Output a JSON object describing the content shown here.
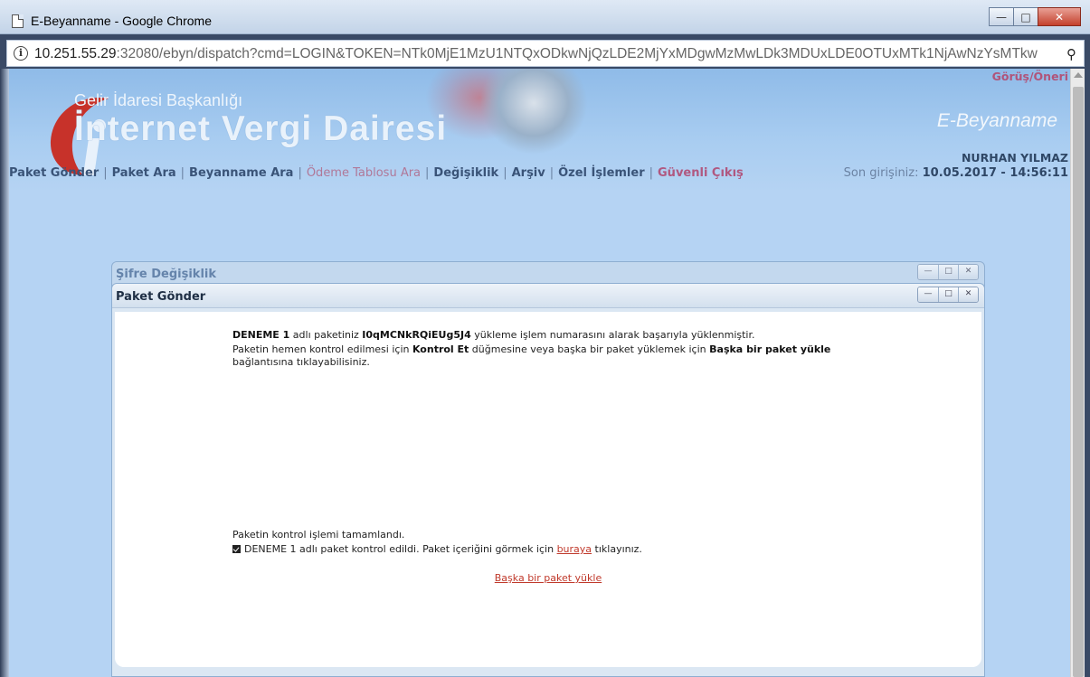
{
  "window": {
    "title": "E-Beyanname - Google Chrome"
  },
  "address_bar": {
    "host": "10.251.55.29",
    "path": ":32080/ebyn/dispatch?cmd=LOGIN&TOKEN=NTk0MjE1MzU1NTQxODkwNjQzLDE2MjYxMDgwMzMwLDk3MDUxLDE0OTUxMTk1NjAwNzYsMTkw"
  },
  "header": {
    "org_name": "Gelir İdaresi Başkanlığı",
    "site_name": "İnternet Vergi Dairesi",
    "feedback_link": "Görüş/Öneri",
    "section_title": "E-Beyanname",
    "user_name": "NURHAN YILMAZ",
    "last_login_label": "Son girişiniz:",
    "last_login_value": "10.05.2017 - 14:56:11"
  },
  "nav": {
    "items": [
      {
        "label": "Paket Gönder"
      },
      {
        "label": "Paket Ara"
      },
      {
        "label": "Beyanname Ara"
      },
      {
        "label": "Ödeme Tablosu Ara"
      },
      {
        "label": "Değişiklik"
      },
      {
        "label": "Arşiv"
      },
      {
        "label": "Özel İşlemler"
      },
      {
        "label": "Güvenli Çıkış"
      }
    ]
  },
  "windows": {
    "back_title": "Şifre Değişiklik",
    "front_title": "Paket Gönder"
  },
  "content": {
    "package_name": "DENEME 1",
    "msg1_mid": " adlı paketiniz ",
    "upload_no": "I0qMCNkRQiEUg5J4",
    "msg1_end": " yükleme işlem numarasını alarak başarıyla yüklenmiştir.",
    "msg2_start": "Paketin hemen kontrol edilmesi için ",
    "control_button_name": "Kontrol Et",
    "msg2_mid": " düğmesine veya başka bir paket yüklemek için ",
    "another_upload_name": "Başka bir paket yükle",
    "msg2_end": " bağlantısına tıklayabilisiniz.",
    "check_done": "Paketin kontrol işlemi tamamlandı.",
    "check_result_start": "DENEME 1 adlı paket kontrol edildi. Paket içeriğini görmek için ",
    "here_link": "buraya",
    "check_result_end": " tıklayınız.",
    "upload_another_link": "Başka bir paket yükle"
  }
}
